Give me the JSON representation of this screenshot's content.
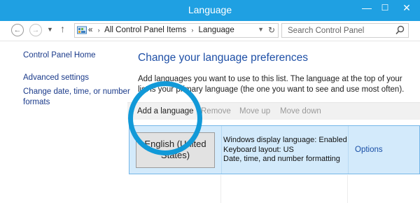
{
  "window": {
    "title": "Language",
    "titlebar_color": "#1fa0e2",
    "controls": {
      "minimize": "—",
      "maximize": "☐",
      "close": "✕"
    }
  },
  "nav": {
    "back_icon": "back-arrow-icon",
    "forward_icon": "forward-arrow-icon",
    "recent_icon": "chevron-down-icon",
    "up_icon": "up-arrow-icon",
    "address": {
      "icon": "control-panel-icon",
      "prefix": "«",
      "crumbs": [
        "All Control Panel Items",
        "Language"
      ],
      "separator": "›"
    },
    "search_placeholder": "Search Control Panel"
  },
  "sidebar": {
    "home": "Control Panel Home",
    "links": [
      "Advanced settings",
      "Change date, time, or number",
      "formats"
    ]
  },
  "main": {
    "title": "Change your language preferences",
    "description": "Add languages you want to use to this list. The language at the top of your list is your primary language (the one you want to see and use most often).",
    "toolbar": {
      "add": "Add a language",
      "remove": "Remove",
      "move_up": "Move up",
      "move_down": "Move down"
    },
    "language": {
      "name": "English (United States)",
      "details": [
        "Windows display language: Enabled",
        "Keyboard layout: US",
        "Date, time, and number formatting"
      ],
      "options": "Options"
    }
  },
  "highlight_color": "#1199d8"
}
